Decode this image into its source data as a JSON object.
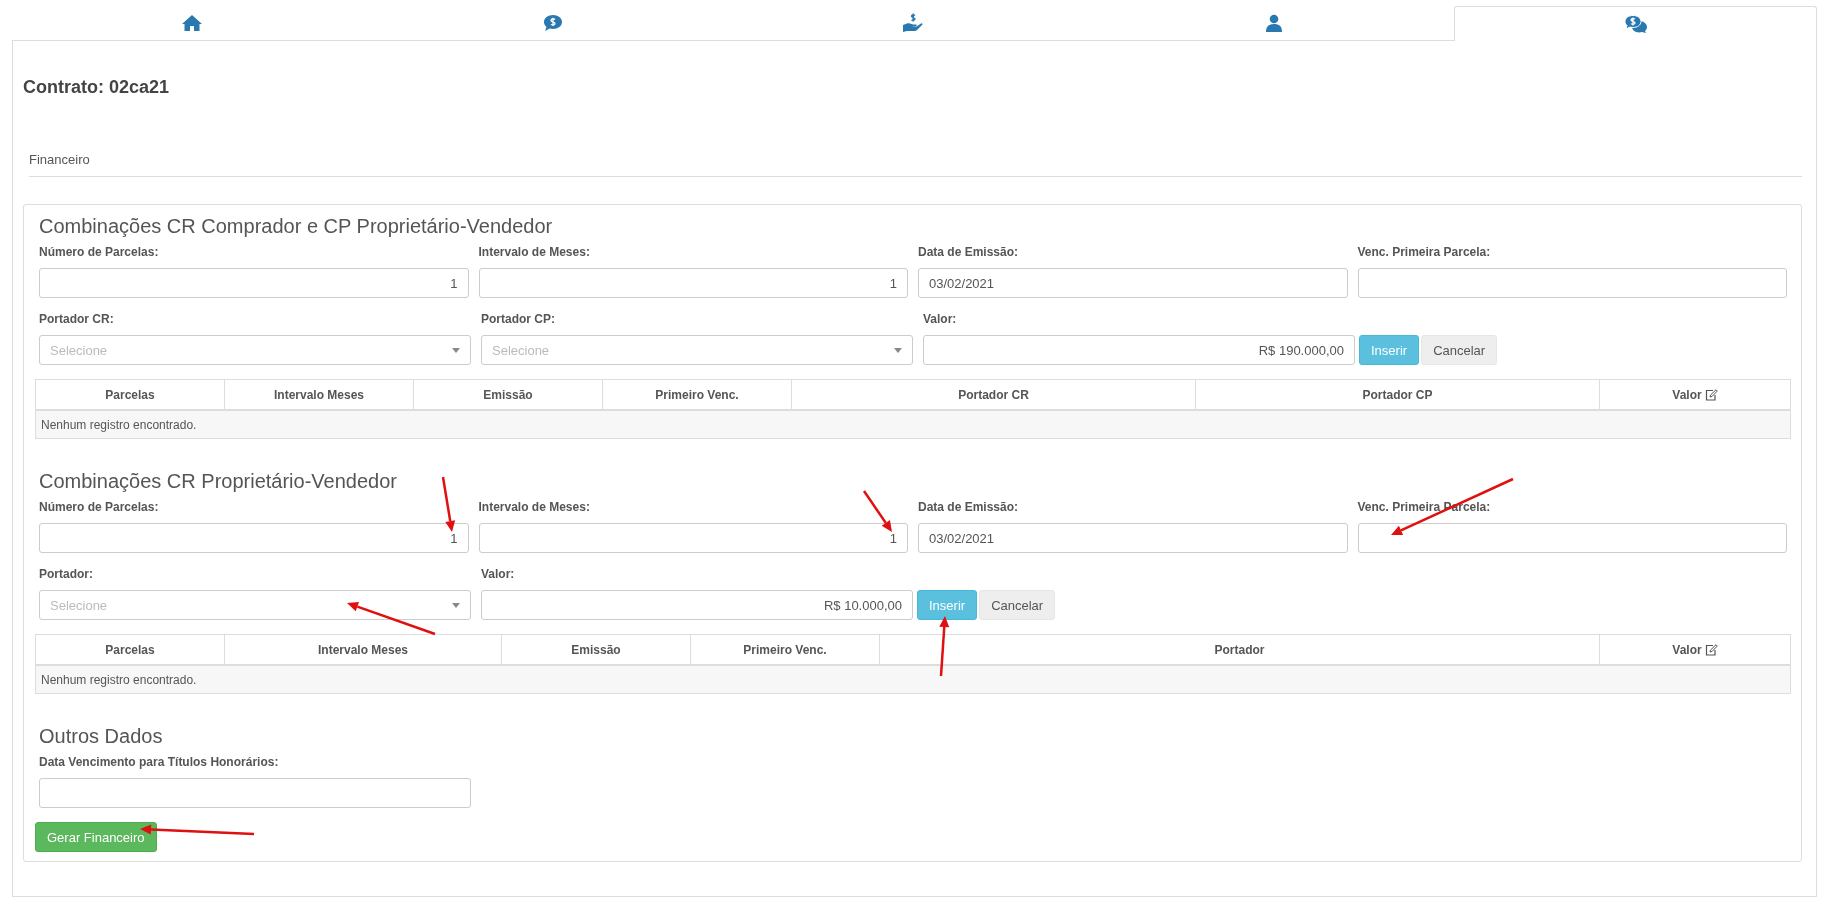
{
  "tabs": [
    {
      "kind": "home",
      "selected": false
    },
    {
      "kind": "bubble-dollar",
      "selected": false
    },
    {
      "kind": "hand-dollar",
      "selected": false
    },
    {
      "kind": "user",
      "selected": false
    },
    {
      "kind": "bubbles-dollar",
      "selected": true
    }
  ],
  "contract_title": "Contrato: 02ca21",
  "section_heading": "Financeiro",
  "sections": [
    {
      "title": "Combinações CR Comprador e CP Proprietário-Vendedor",
      "rows": [
        [
          {
            "label": "Número de Parcelas:",
            "kind": "number",
            "value": "1"
          },
          {
            "label": "Intervalo de Meses:",
            "kind": "number",
            "value": "1"
          },
          {
            "label": "Data de Emissão:",
            "kind": "text",
            "value": "03/02/2021"
          },
          {
            "label": "Venc. Primeira Parcela:",
            "kind": "text"
          }
        ],
        [
          {
            "label": "Portador CR:",
            "kind": "select",
            "placeholder": "Selecione"
          },
          {
            "label": "Portador CP:",
            "kind": "select",
            "placeholder": "Selecione"
          },
          {
            "label": "Valor:",
            "kind": "number",
            "value": "R$ 190.000,00"
          }
        ]
      ],
      "actions": [
        {
          "label": "Inserir",
          "kind": "primary"
        },
        {
          "label": "Cancelar",
          "kind": "default"
        }
      ],
      "table": {
        "columns": [
          {
            "label": "Parcelas"
          },
          {
            "label": "Intervalo Meses"
          },
          {
            "label": "Emissão"
          },
          {
            "label": "Primeiro Venc."
          },
          {
            "label": "Portador CR"
          },
          {
            "label": "Portador CP"
          },
          {
            "label": "Valor",
            "editable": true
          }
        ],
        "empty_message": "Nenhum registro encontrado."
      }
    },
    {
      "title": "Combinações CR Proprietário-Vendedor",
      "rows": [
        [
          {
            "label": "Número de Parcelas:",
            "kind": "number",
            "value": "1"
          },
          {
            "label": "Intervalo de Meses:",
            "kind": "number",
            "value": "1"
          },
          {
            "label": "Data de Emissão:",
            "kind": "text",
            "value": "03/02/2021"
          },
          {
            "label": "Venc. Primeira Parcela:",
            "kind": "text"
          }
        ],
        [
          {
            "label": "Portador:",
            "kind": "select",
            "placeholder": "Selecione"
          },
          {
            "label": "Valor:",
            "kind": "number",
            "value": "R$ 10.000,00"
          }
        ]
      ],
      "actions": [
        {
          "label": "Inserir",
          "kind": "primary"
        },
        {
          "label": "Cancelar",
          "kind": "default"
        }
      ],
      "table": {
        "columns": [
          {
            "label": "Parcelas"
          },
          {
            "label": "Intervalo Meses"
          },
          {
            "label": "Emissão"
          },
          {
            "label": "Primeiro Venc."
          },
          {
            "label": "Portador"
          },
          {
            "label": "Valor",
            "editable": true
          }
        ],
        "empty_message": "Nenhum registro encontrado."
      }
    }
  ],
  "other_data": {
    "title": "Outros Dados",
    "fields": [
      {
        "label": "Data Vencimento para Títulos Honorários:",
        "kind": "text"
      }
    ]
  },
  "generate_button": {
    "label": "Gerar Financeiro",
    "kind": "success"
  }
}
